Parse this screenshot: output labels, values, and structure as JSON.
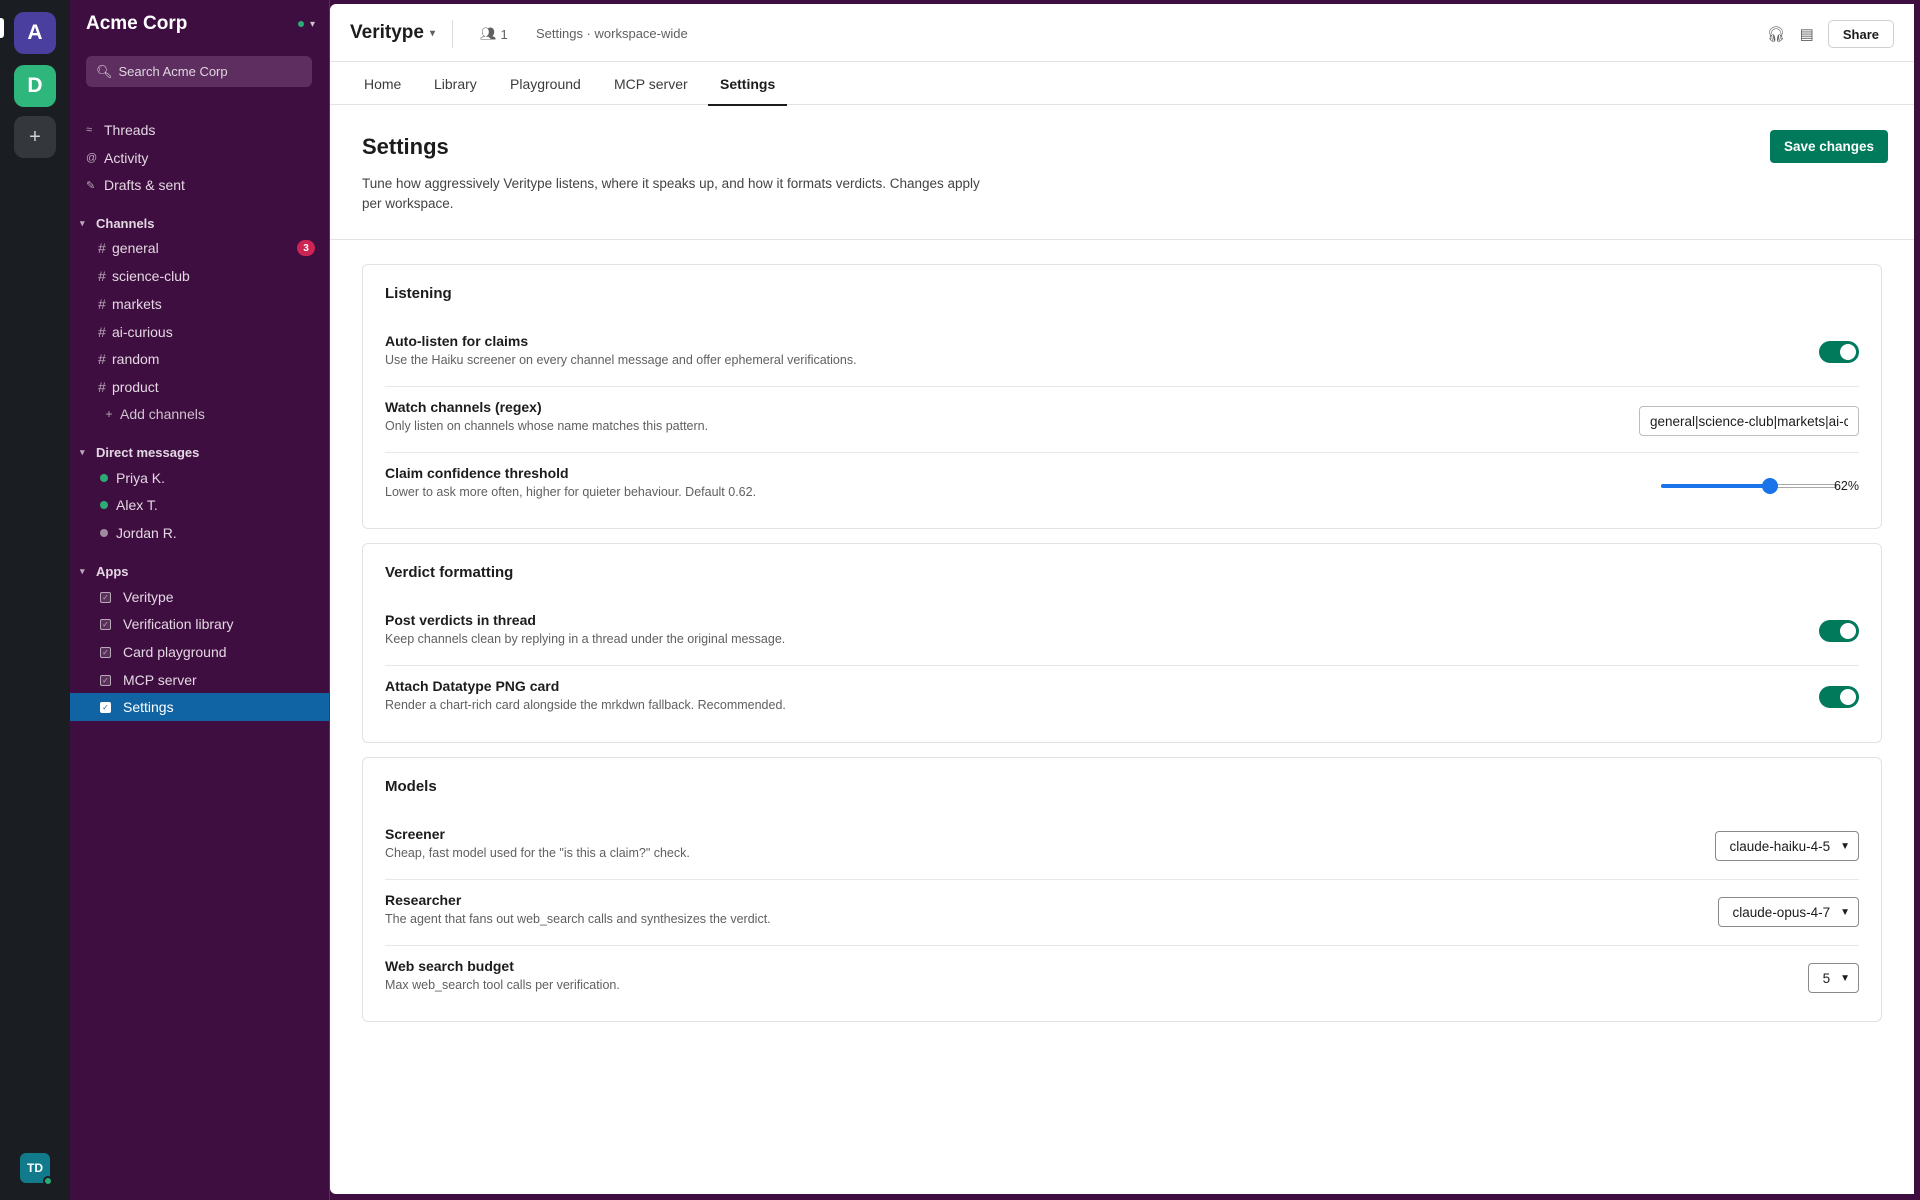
{
  "rail": {
    "workspaces": [
      "A",
      "D"
    ],
    "add": "+",
    "user_initials": "TD"
  },
  "sidebar": {
    "workspace_name": "Acme Corp",
    "search_placeholder": "Search Acme Corp",
    "top_items": [
      {
        "label": "Threads",
        "icon": "threads-icon"
      },
      {
        "label": "Activity",
        "icon": "at-icon"
      },
      {
        "label": "Drafts & sent",
        "icon": "pencil-icon"
      }
    ],
    "channels_header": "Channels",
    "channels": [
      {
        "name": "general",
        "badge": "3"
      },
      {
        "name": "science-club"
      },
      {
        "name": "markets"
      },
      {
        "name": "ai-curious"
      },
      {
        "name": "random"
      },
      {
        "name": "product"
      }
    ],
    "add_channels": "Add channels",
    "dms_header": "Direct messages",
    "dms": [
      {
        "name": "Priya K.",
        "status_color": "#2bac76"
      },
      {
        "name": "Alex T.",
        "status_color": "#2bac76"
      },
      {
        "name": "Jordan R.",
        "status_color": "#a08aa0"
      }
    ],
    "apps_header": "Apps",
    "apps": [
      "Veritype",
      "Verification library",
      "Card playground",
      "MCP server",
      "Settings"
    ]
  },
  "header": {
    "app_name": "Veritype",
    "member_count": "1",
    "subtitle": "Settings · workspace-wide",
    "share_label": "Share"
  },
  "tabs": [
    "Home",
    "Library",
    "Playground",
    "MCP server",
    "Settings"
  ],
  "page": {
    "title": "Settings",
    "description": "Tune how aggressively Veritype listens, where it speaks up, and how it formats verdicts. Changes apply per workspace.",
    "save_label": "Save changes"
  },
  "listening": {
    "title": "Listening",
    "auto_listen": {
      "label": "Auto-listen for claims",
      "help": "Use the Haiku screener on every channel message and offer ephemeral verifications.",
      "on": true
    },
    "watch_channels": {
      "label": "Watch channels (regex)",
      "help": "Only listen on channels whose name matches this pattern.",
      "value": "general|science-club|markets|ai-curious"
    },
    "threshold": {
      "label": "Claim confidence threshold",
      "help": "Lower to ask more often, higher for quieter behaviour. Default 0.62.",
      "value": 0.62,
      "display": "62%"
    }
  },
  "verdict": {
    "title": "Verdict formatting",
    "post_in_thread": {
      "label": "Post verdicts in thread",
      "help": "Keep channels clean by replying in a thread under the original message.",
      "on": true
    },
    "attach_png": {
      "label": "Attach Datatype PNG card",
      "help": "Render a chart-rich card alongside the mrkdwn fallback. Recommended.",
      "on": true
    }
  },
  "models": {
    "title": "Models",
    "screener": {
      "label": "Screener",
      "help": "Cheap, fast model used for the \"is this a claim?\" check.",
      "value": "claude-haiku-4-5"
    },
    "researcher": {
      "label": "Researcher",
      "help": "The agent that fans out web_search calls and synthesizes the verdict.",
      "value": "claude-opus-4-7"
    },
    "budget": {
      "label": "Web search budget",
      "help": "Max web_search tool calls per verification.",
      "value": "5"
    }
  },
  "colors": {
    "accent": "#007a5a",
    "sidebar": "#3f0e40",
    "active_item": "#1164a3",
    "slider": "#1a73e8"
  }
}
